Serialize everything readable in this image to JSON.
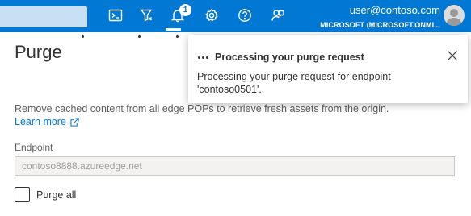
{
  "topbar": {
    "notification_count": "1",
    "account": {
      "email": "user@contoso.com",
      "org": "MICROSOFT (MICROSOFT.ONMI..."
    },
    "icons": [
      "cloud-shell-icon",
      "directory-filter-icon",
      "notifications-icon",
      "settings-icon",
      "help-icon",
      "feedback-icon"
    ]
  },
  "page": {
    "title": "Purge",
    "description": "Remove cached content from all edge POPs to retrieve fresh assets from the origin.",
    "learn_more": "Learn more",
    "endpoint_label": "Endpoint",
    "endpoint_value": "contoso8888.azureedge.net",
    "purge_all_label": "Purge all"
  },
  "notification": {
    "title": "Processing your purge request",
    "message": "Processing your purge request for endpoint 'contoso0501'."
  },
  "colors": {
    "topbar": "#0078d4",
    "link": "#0078d4",
    "text": "#323130",
    "muted": "#605e5c"
  }
}
